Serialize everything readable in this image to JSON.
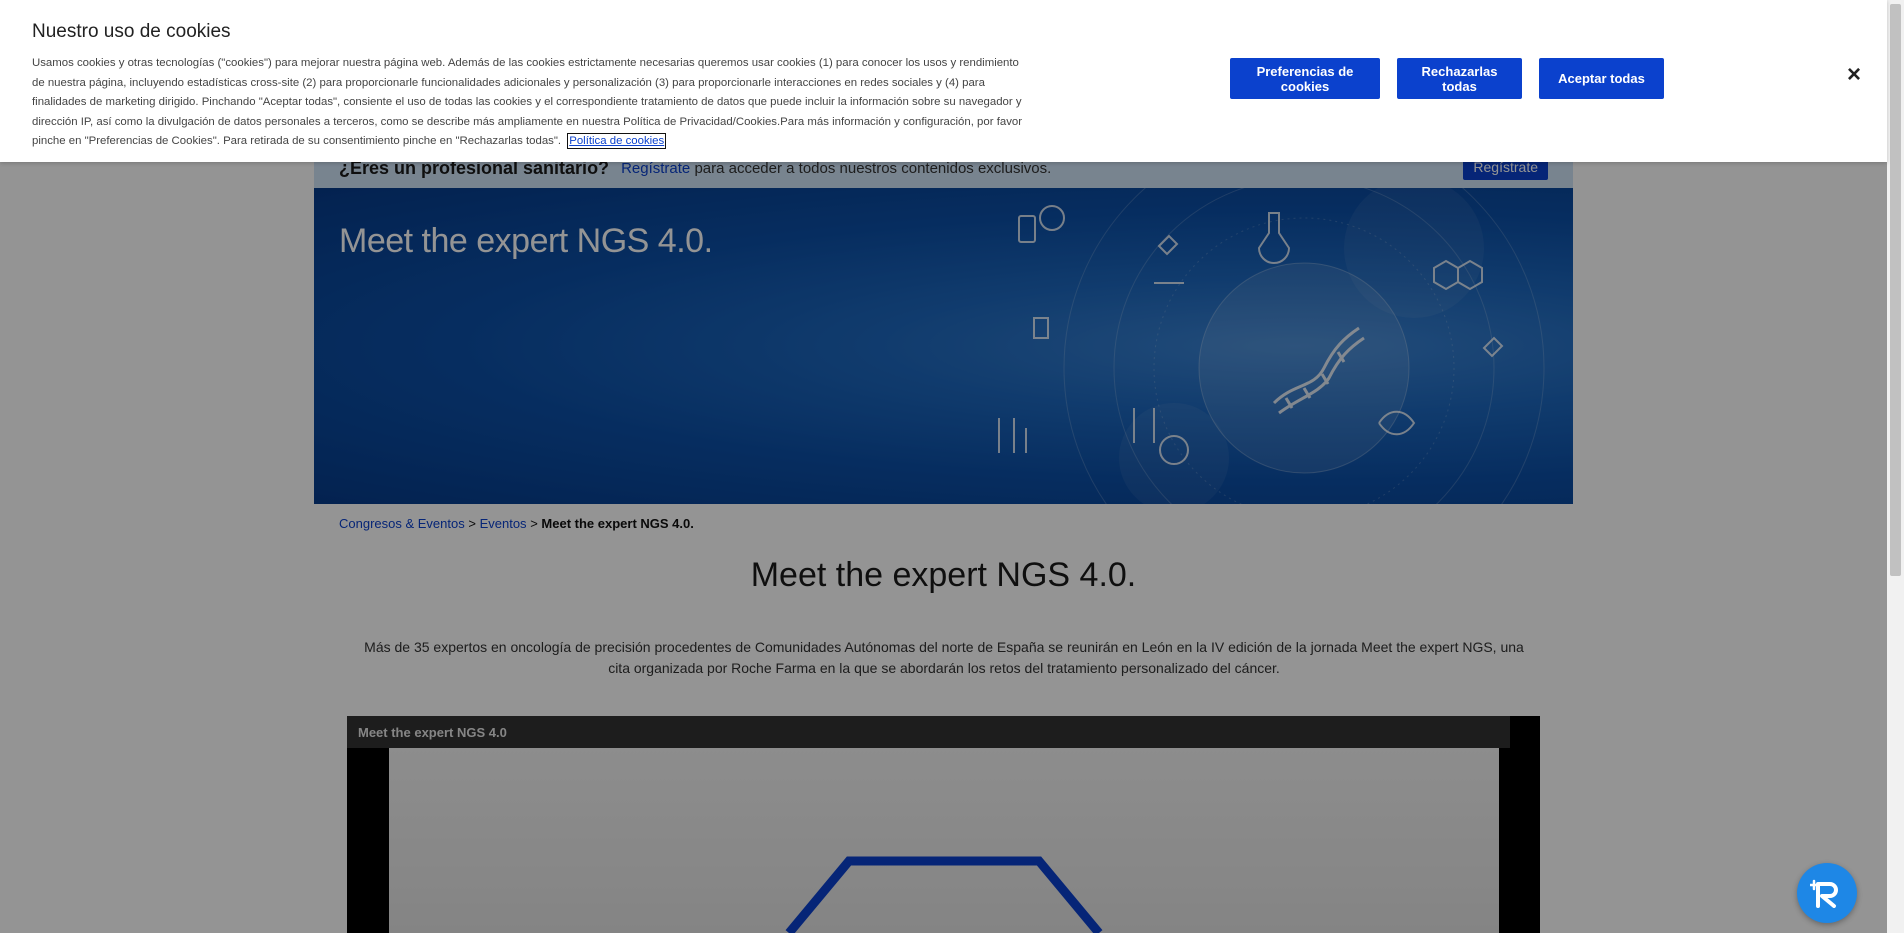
{
  "cookie_banner": {
    "title": "Nuestro uso de cookies",
    "body": "Usamos cookies y otras tecnologías (\"cookies\") para mejorar nuestra página web. Además de las cookies estrictamente necesarias queremos usar cookies (1) para conocer los usos y rendimiento de nuestra página, incluyendo estadísticas cross-site (2) para proporcionarle funcionalidades adicionales y personalización (3) para proporcionarle interacciones en redes sociales y (4) para finalidades de marketing dirigido. Pinchando \"Aceptar todas\", consiente el uso de todas las cookies y el correspondiente tratamiento de datos que puede incluir la información sobre su navegador y dirección IP, así como la divulgación de datos personales a terceros, como se describe más ampliamente en nuestra Política de Privacidad/Cookies.Para más información y configuración, por favor pinche en \"Preferencias de Cookies\". Para retirada de su consentimiento pinche en \"Rechazarlas todas\".",
    "policy_link": "Política de cookies",
    "preferences_label": "Preferencias de cookies",
    "reject_label": "Rechazarlas todas",
    "accept_label": "Aceptar todas",
    "close_icon": "×"
  },
  "pro_banner": {
    "title": "¿Eres un profesional sanitario?",
    "link": "Regístrate",
    "text": "para acceder a todos nuestros contenidos exclusivos.",
    "button": "Regístrate"
  },
  "hero": {
    "title": "Meet the expert NGS 4.0."
  },
  "breadcrumb": {
    "item1": "Congresos & Eventos",
    "sep": ">",
    "item2": "Eventos",
    "current": "Meet the expert NGS 4.0."
  },
  "article": {
    "title": "Meet the expert NGS 4.0.",
    "description": "Más de 35 expertos en oncología de precisión procedentes de Comunidades Autónomas del norte de España se reunirán en León en la IV edición de la jornada Meet the expert NGS, una cita organizada por Roche Farma en la que se abordarán los retos del tratamiento personalizado del cáncer."
  },
  "video": {
    "title": "Meet the expert NGS 4.0"
  },
  "icons": {
    "close": "close-icon",
    "chat": "chat-assistant-icon",
    "dna": "dna-icon"
  },
  "colors": {
    "brand_blue": "#0b41cd",
    "hero_blue": "#0c4fa6",
    "fab_blue": "#1e87e6"
  }
}
